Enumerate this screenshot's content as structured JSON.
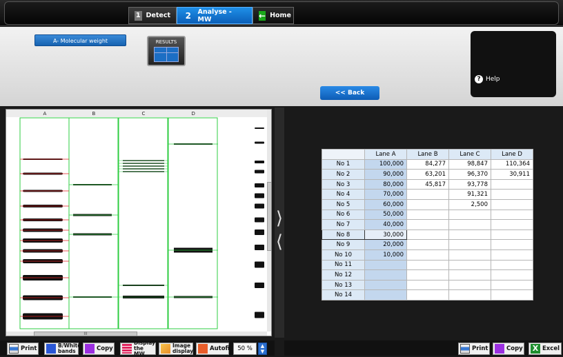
{
  "nav": {
    "detect_num": "1",
    "detect_label": "Detect",
    "analyse_num": "2",
    "analyse_label": "Analyse - MW",
    "home_label": "Home"
  },
  "panel": {
    "mw_button": "A- Molecular weight",
    "results_label": "RESULTS",
    "back_label": "<< Back",
    "help_label": "Help"
  },
  "gel": {
    "lane_labels": [
      "A",
      "B",
      "C",
      "D"
    ],
    "hscroll_label": "III"
  },
  "table": {
    "headers": [
      "Lane A",
      "Lane B",
      "Lane C",
      "Lane D"
    ],
    "selected_row": 7,
    "rows": [
      {
        "label": "No 1",
        "a": "100,000",
        "b": "84,277",
        "c": "98,847",
        "d": "110,364"
      },
      {
        "label": "No 2",
        "a": "90,000",
        "b": "63,201",
        "c": "96,370",
        "d": "30,911"
      },
      {
        "label": "No 3",
        "a": "80,000",
        "b": "45,817",
        "c": "93,778",
        "d": ""
      },
      {
        "label": "No 4",
        "a": "70,000",
        "b": "",
        "c": "91,321",
        "d": ""
      },
      {
        "label": "No 5",
        "a": "60,000",
        "b": "",
        "c": "2,500",
        "d": ""
      },
      {
        "label": "No 6",
        "a": "50,000",
        "b": "",
        "c": "",
        "d": ""
      },
      {
        "label": "No 7",
        "a": "40,000",
        "b": "",
        "c": "",
        "d": ""
      },
      {
        "label": "No 8",
        "a": "30,000",
        "b": "",
        "c": "",
        "d": ""
      },
      {
        "label": "No 9",
        "a": "20,000",
        "b": "",
        "c": "",
        "d": ""
      },
      {
        "label": "No 10",
        "a": "10,000",
        "b": "",
        "c": "",
        "d": ""
      },
      {
        "label": "No 11",
        "a": "",
        "b": "",
        "c": "",
        "d": ""
      },
      {
        "label": "No 12",
        "a": "",
        "b": "",
        "c": "",
        "d": ""
      },
      {
        "label": "No 13",
        "a": "",
        "b": "",
        "c": "",
        "d": ""
      },
      {
        "label": "No 14",
        "a": "",
        "b": "",
        "c": "",
        "d": ""
      }
    ]
  },
  "left_toolbar": {
    "print": "Print",
    "bw_line1": "B/White",
    "bw_line2": "bands",
    "copy": "Copy",
    "display_line1": "Display",
    "display_line2": "the MW",
    "image_line1": "Image",
    "image_line2": "display",
    "autofit": "Autofit",
    "zoom": "50 %"
  },
  "right_toolbar": {
    "print": "Print",
    "copy": "Copy",
    "excel": "Excel"
  },
  "colors": {
    "accent_blue": "#1a73d4",
    "lane_green": "#2ecc40",
    "mw_red": "#e02020",
    "band": "#111111"
  }
}
